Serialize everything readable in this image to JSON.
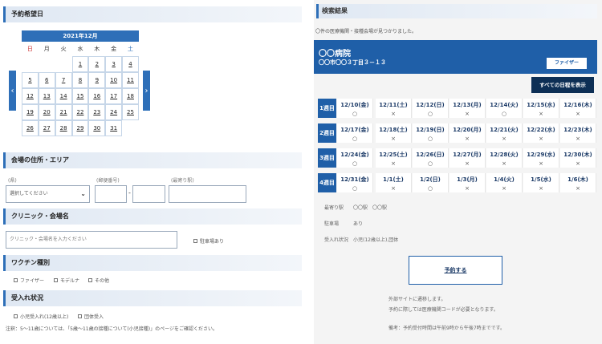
{
  "left": {
    "date_section_title": "予約希望日",
    "calendar": {
      "month": "2021年12月",
      "weekdays": [
        "日",
        "月",
        "火",
        "水",
        "木",
        "金",
        "土"
      ],
      "rows": [
        [
          "",
          "",
          "",
          "1",
          "2",
          "3",
          "4"
        ],
        [
          "5",
          "6",
          "7",
          "8",
          "9",
          "10",
          "11"
        ],
        [
          "12",
          "13",
          "14",
          "15",
          "16",
          "17",
          "18"
        ],
        [
          "19",
          "20",
          "21",
          "22",
          "23",
          "24",
          "25"
        ],
        [
          "26",
          "27",
          "28",
          "29",
          "30",
          "31",
          ""
        ]
      ],
      "prev_icon": "‹",
      "next_icon": "›"
    },
    "area_section_title": "会場の住所・エリア",
    "area": {
      "pref_label": "(県)",
      "pref_value": "選択してください",
      "code_label": "(郵便番号)",
      "city_label": "(最寄り駅)",
      "dash": "-"
    },
    "clinic_section_title": "クリニック・会場名",
    "clinic": {
      "placeholder": "クリニック・会場名を入力ください",
      "checkbox": "駐車場あり"
    },
    "vaccine_section_title": "ワクチン種別",
    "vaccine": {
      "options": [
        "ファイザー",
        "モデルナ",
        "その他"
      ]
    },
    "accept_section_title": "受入れ状況",
    "accept": {
      "options": [
        "小児受入れ(12歳以上)",
        "団体受入"
      ]
    },
    "note": "注釈：5～11歳については、「5歳～11歳の接種について(小児接種)」のページをご確認ください。"
  },
  "right": {
    "result_title": "検索結果",
    "result_text": "〇件の医療機関・接種会場が見つかりました。",
    "hospital_name": "〇〇病院",
    "hospital_address": "〇〇市〇〇３丁目３－１３",
    "pfizer_label": "ファイザー",
    "show_all_label": "すべての日程を表示",
    "weeks": [
      {
        "label": "1週目",
        "days": [
          {
            "d": "12/10(金)",
            "s": "○"
          },
          {
            "d": "12/11(土)",
            "s": "×"
          },
          {
            "d": "12/12(日)",
            "s": "○"
          },
          {
            "d": "12/13(月)",
            "s": "×"
          },
          {
            "d": "12/14(火)",
            "s": "○"
          },
          {
            "d": "12/15(水)",
            "s": "×"
          },
          {
            "d": "12/16(木)",
            "s": "×"
          }
        ]
      },
      {
        "label": "2週目",
        "days": [
          {
            "d": "12/17(金)",
            "s": "○"
          },
          {
            "d": "12/18(土)",
            "s": "×"
          },
          {
            "d": "12/19(日)",
            "s": "○"
          },
          {
            "d": "12/20(月)",
            "s": "×"
          },
          {
            "d": "12/21(火)",
            "s": "×"
          },
          {
            "d": "12/22(水)",
            "s": "×"
          },
          {
            "d": "12/23(木)",
            "s": "×"
          }
        ]
      },
      {
        "label": "3週目",
        "days": [
          {
            "d": "12/24(金)",
            "s": "○"
          },
          {
            "d": "12/25(土)",
            "s": "×"
          },
          {
            "d": "12/26(日)",
            "s": "○"
          },
          {
            "d": "12/27(月)",
            "s": "×"
          },
          {
            "d": "12/28(火)",
            "s": "×"
          },
          {
            "d": "12/29(水)",
            "s": "×"
          },
          {
            "d": "12/30(木)",
            "s": "×"
          }
        ]
      },
      {
        "label": "4週目",
        "days": [
          {
            "d": "12/31(金)",
            "s": "○"
          },
          {
            "d": "1/1(土)",
            "s": "×"
          },
          {
            "d": "1/2(日)",
            "s": "○"
          },
          {
            "d": "1/3(月)",
            "s": "×"
          },
          {
            "d": "1/4(火)",
            "s": "×"
          },
          {
            "d": "1/5(水)",
            "s": "×"
          },
          {
            "d": "1/6(木)",
            "s": "×"
          }
        ]
      }
    ],
    "info": [
      {
        "k": "最寄り駅",
        "v": "〇〇駅　〇〇駅"
      },
      {
        "k": "駐車場",
        "v": "あり"
      },
      {
        "k": "受入れ状況",
        "v": "小児(12歳以上),団体"
      }
    ],
    "reserve_label": "予約する",
    "notes": [
      "外部サイトに遷移します。",
      "予約に際しては医療機関コードが必要となります。",
      "備考：予約受付時間は午前9時から午後7時までです。"
    ]
  }
}
